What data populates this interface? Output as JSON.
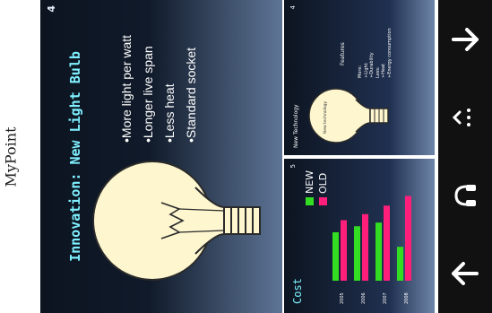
{
  "caption": "MyPoint",
  "slide": {
    "title": "Innovation: New Light Bulb",
    "page_number": "4",
    "bullets": [
      "•More light per watt",
      "•Longer live span",
      "•Less heat",
      "•Standard socket"
    ]
  },
  "thumbnails": {
    "left": {
      "title": "Cost",
      "page_number": "5",
      "legend": [
        "NEW",
        "OLD"
      ],
      "colors": {
        "new": "#33dd22",
        "old": "#ff1f7a"
      }
    },
    "right": {
      "title": "New Technology",
      "bulb_label": "New technology",
      "features_title": "Features",
      "features": [
        "More:",
        "➢Light",
        "➢Durability",
        "Less:",
        "➢Heat",
        "➢Energy consumption"
      ],
      "page_number": "4"
    }
  },
  "chart_data": {
    "type": "bar",
    "categories": [
      "2005",
      "2006",
      "2007",
      "2008"
    ],
    "series": [
      {
        "name": "NEW",
        "values": [
          40,
          45,
          48,
          28
        ]
      },
      {
        "name": "OLD",
        "values": [
          50,
          55,
          62,
          70
        ]
      }
    ],
    "title": "Cost",
    "xlabel": "",
    "ylabel": ""
  },
  "navbar": {
    "buttons": [
      "up-arrow-icon",
      "headset-icon",
      "chevron-menu-icon",
      "down-arrow-icon"
    ]
  }
}
